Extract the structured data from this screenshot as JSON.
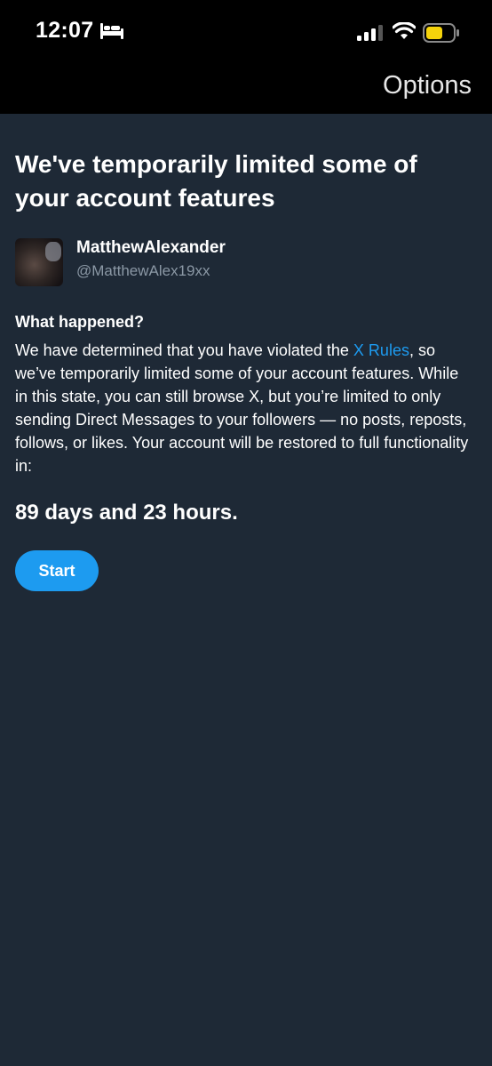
{
  "status_bar": {
    "time": "12:07"
  },
  "nav": {
    "options_label": "Options"
  },
  "page": {
    "title": "We've temporarily limited some of your account features"
  },
  "user": {
    "display_name": "MatthewAlexander",
    "handle": "@MatthewAlex19xx"
  },
  "notice": {
    "heading": "What happened?",
    "text_before_link": "We have determined that you have violated the ",
    "link_text": "X Rules",
    "text_after_link": ", so we’ve temporarily limited some of your account features. While in this state, you can still browse X, but you’re limited to only sending Direct Messages to your followers — no posts, reposts, follows, or likes. Your account will be restored to full functionality in:",
    "countdown": "89 days and 23 hours."
  },
  "actions": {
    "start_label": "Start"
  },
  "colors": {
    "background": "#1e2936",
    "accent": "#1d9bf0",
    "secondary_text": "#8b98a5",
    "battery": "#f5d30b"
  },
  "icons": [
    "sleep-bed-icon",
    "cellular-signal-icon",
    "wifi-icon",
    "battery-icon"
  ]
}
